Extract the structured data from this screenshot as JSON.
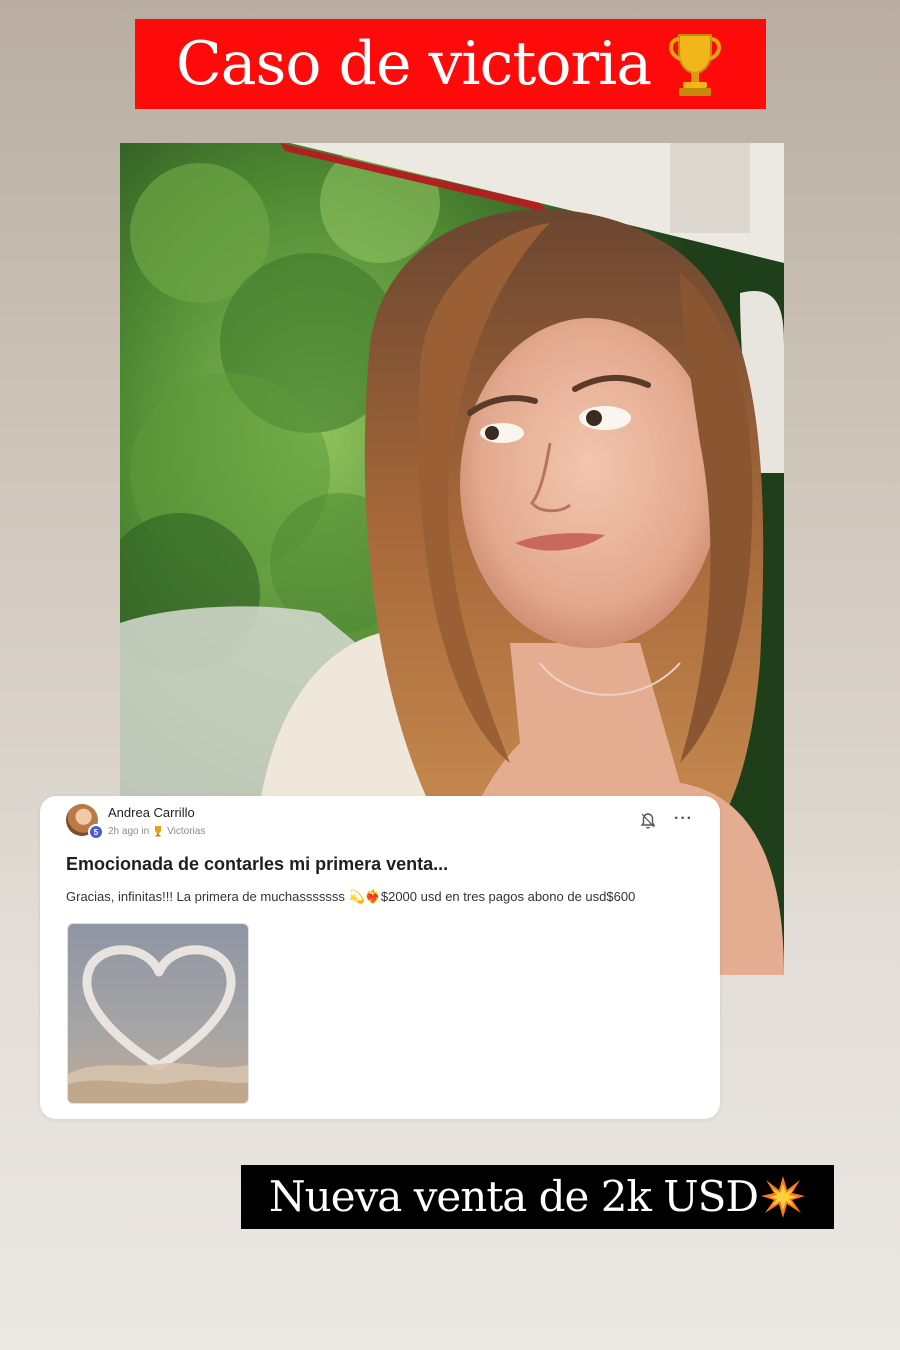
{
  "top_banner": {
    "text": "Caso de victoria",
    "icon": "trophy-icon",
    "background": "#ff0a0a"
  },
  "photo": {
    "subject": "selfie-photo"
  },
  "post": {
    "author": "Andrea Carrillo",
    "level_badge": "5",
    "time": "2h ago in",
    "category_icon": "trophy-icon",
    "category": "Victorias",
    "title": "Emocionada de contarles mi primera venta...",
    "body": "Gracias, infinitas!!! La primera de muchasssssss 💫❤️‍🔥$2000 usd en tres pagos abono de usd$600",
    "image": "heart-cloud-image"
  },
  "bottom_banner": {
    "text": "Nueva venta de 2k USD",
    "icon": "burst-icon",
    "background": "#000000"
  },
  "colors": {
    "accent_red": "#ff0a0a",
    "badge_blue": "#4c5bd4"
  }
}
